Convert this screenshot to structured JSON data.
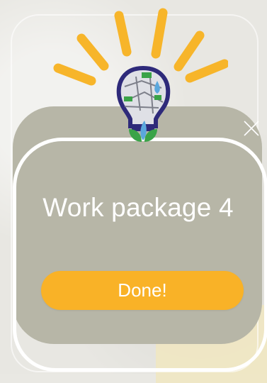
{
  "dialog": {
    "title": "Work package 4",
    "done_label": "Done!"
  },
  "icons": {
    "logo": "lightbulb-logo-icon",
    "close": "close-icon"
  },
  "colors": {
    "background": "#e8e7e2",
    "card": "#b7b6a7",
    "button": "#f9b227",
    "text": "#ffffff",
    "rays": "#f7b52a",
    "bulb_outline": "#2e2a7a",
    "leaf_green": "#3aa348",
    "leaf_blue": "#5aa7dd"
  }
}
